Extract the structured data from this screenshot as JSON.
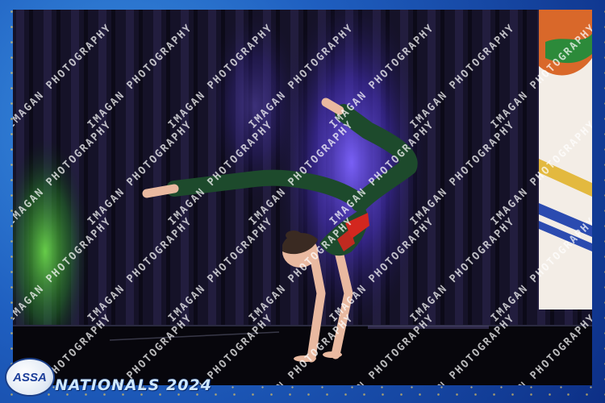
{
  "photo": {
    "subject": "gymnast-handstand",
    "colors": {
      "curtain": "#141226",
      "stage_light": "#5b3fd8",
      "green_light": "#3fae3a",
      "leotard_green": "#1d4a2c",
      "leotard_red": "#d3271f",
      "frame_blue": "#1f5fc0"
    }
  },
  "watermark": {
    "text": "IMAGAN PHOTOGRAPHY"
  },
  "logo": {
    "text": "ASSA"
  },
  "event": {
    "title": "NATIONALS 2024"
  }
}
